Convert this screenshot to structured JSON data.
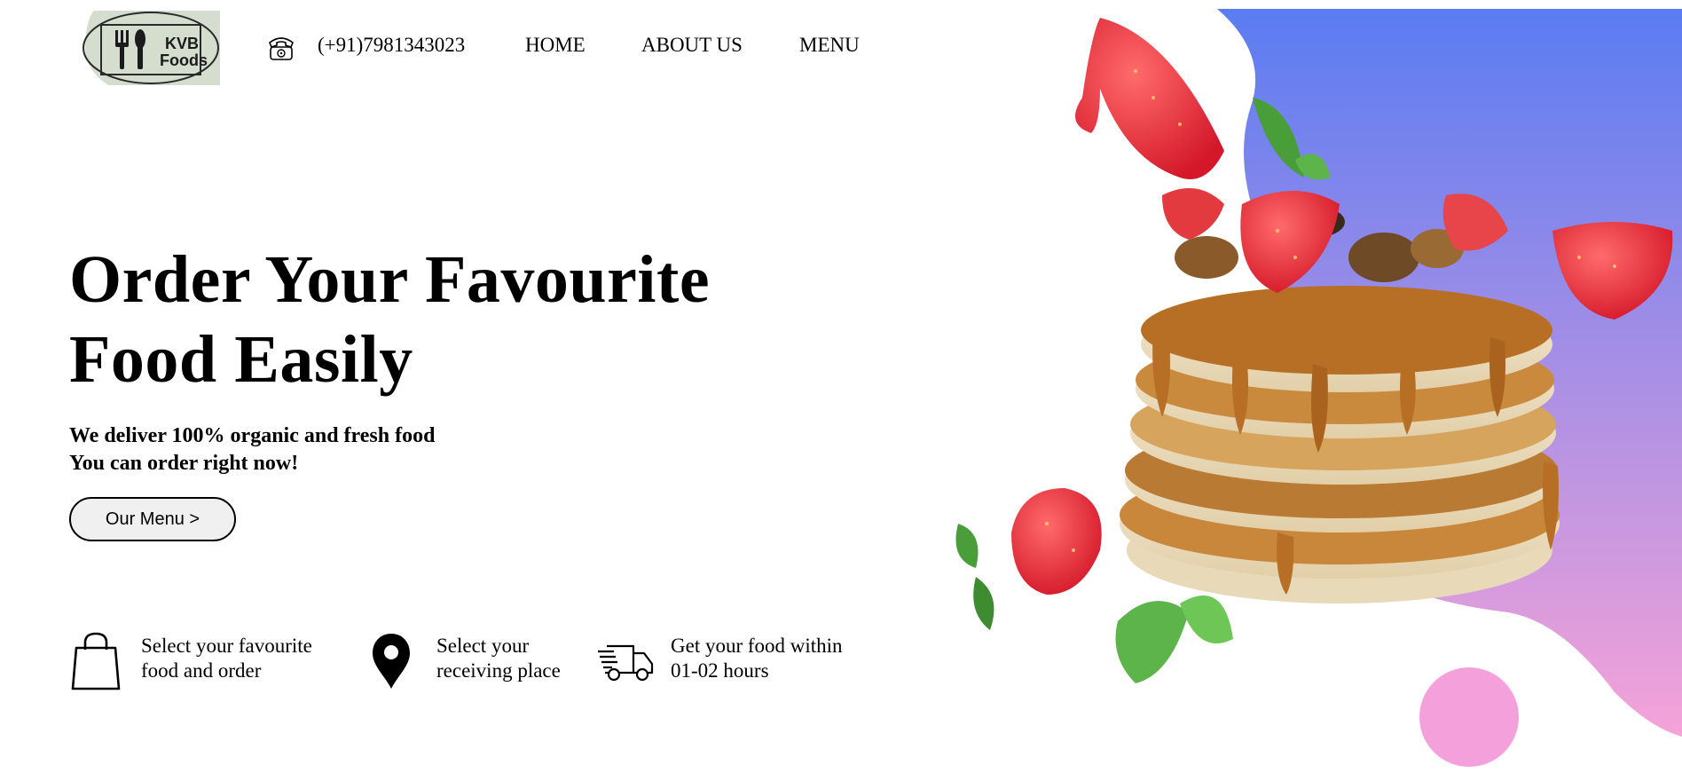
{
  "brand": {
    "logo_text_line1": "KVB",
    "logo_text_line2": "Foods"
  },
  "header": {
    "phone": "(+91)7981343023",
    "nav": [
      "HOME",
      "ABOUT US",
      "MENU"
    ]
  },
  "hero": {
    "title_line1": "Order Your Favourite",
    "title_line2": "Food Easily",
    "subtitle_line1": "We deliver 100% organic and fresh food",
    "subtitle_line2": "You can order right now!",
    "cta_label": "Our Menu >"
  },
  "features": [
    {
      "icon": "shopping-bag-icon",
      "line1": "Select your favourite",
      "line2": "food and order"
    },
    {
      "icon": "location-pin-icon",
      "line1": "Select your",
      "line2": "receiving place"
    },
    {
      "icon": "delivery-truck-icon",
      "line1": "Get your food within",
      "line2": "01-02 hours"
    }
  ],
  "colors": {
    "gradient_top": "#5a7cf2",
    "gradient_bottom": "#f6a3d8",
    "logo_bg": "#d5dece",
    "pink_circle": "#f4a0da",
    "cta_bg": "#f0f0f0"
  }
}
